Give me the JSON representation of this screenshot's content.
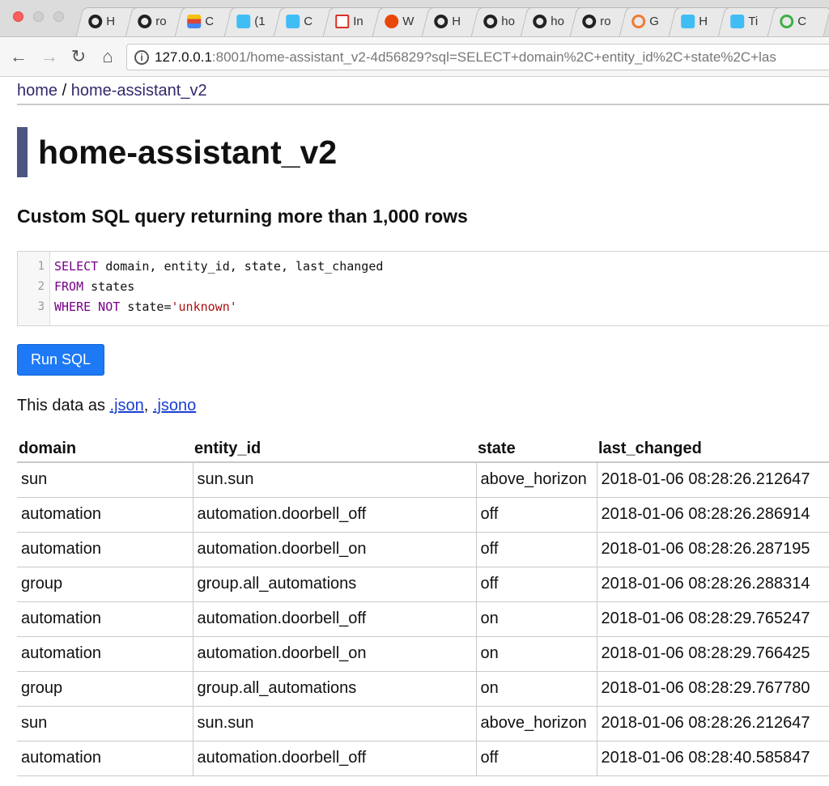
{
  "browser": {
    "tabs": [
      {
        "label": "H",
        "icon": "github-icon"
      },
      {
        "label": "ro",
        "icon": "github-icon"
      },
      {
        "label": "C",
        "icon": "stacked-bars-icon"
      },
      {
        "label": "(1",
        "icon": "home-assistant-icon"
      },
      {
        "label": "C",
        "icon": "home-assistant-icon"
      },
      {
        "label": "In",
        "icon": "gmail-icon"
      },
      {
        "label": "W",
        "icon": "alert-icon"
      },
      {
        "label": "H",
        "icon": "github-icon"
      },
      {
        "label": "ho",
        "icon": "github-icon"
      },
      {
        "label": "ho",
        "icon": "github-icon"
      },
      {
        "label": "ro",
        "icon": "github-icon"
      },
      {
        "label": "G",
        "icon": "ring-icon"
      },
      {
        "label": "H",
        "icon": "home-assistant-icon"
      },
      {
        "label": "Ti",
        "icon": "home-assistant-icon"
      },
      {
        "label": "C",
        "icon": "loading-ring-icon"
      }
    ],
    "url_host": "127.0.0.1",
    "url_rest": ":8001/home-assistant_v2-4d56829?sql=SELECT+domain%2C+entity_id%2C+state%2C+las"
  },
  "breadcrumb": {
    "home": "home",
    "separator": " / ",
    "db": "home-assistant_v2"
  },
  "page_title": "home-assistant_v2",
  "query_heading": "Custom SQL query returning more than 1,000 rows",
  "editor": {
    "lines": [
      {
        "no": "1",
        "kw1": "SELECT",
        "rest": " domain, entity_id, state, last_changed"
      },
      {
        "no": "2",
        "kw1": "FROM",
        "rest": " states"
      },
      {
        "no": "3",
        "kw1": "WHERE NOT",
        "rest": " state=",
        "str": "'unknown'"
      }
    ]
  },
  "run_button": "Run SQL",
  "export": {
    "prefix": "This data as ",
    "json": ".json",
    "sep": ", ",
    "jsono": ".jsono"
  },
  "table": {
    "columns": [
      "domain",
      "entity_id",
      "state",
      "last_changed"
    ],
    "rows": [
      [
        "sun",
        "sun.sun",
        "above_horizon",
        "2018-01-06 08:28:26.212647"
      ],
      [
        "automation",
        "automation.doorbell_off",
        "off",
        "2018-01-06 08:28:26.286914"
      ],
      [
        "automation",
        "automation.doorbell_on",
        "off",
        "2018-01-06 08:28:26.287195"
      ],
      [
        "group",
        "group.all_automations",
        "off",
        "2018-01-06 08:28:26.288314"
      ],
      [
        "automation",
        "automation.doorbell_off",
        "on",
        "2018-01-06 08:28:29.765247"
      ],
      [
        "automation",
        "automation.doorbell_on",
        "on",
        "2018-01-06 08:28:29.766425"
      ],
      [
        "group",
        "group.all_automations",
        "on",
        "2018-01-06 08:28:29.767780"
      ],
      [
        "sun",
        "sun.sun",
        "above_horizon",
        "2018-01-06 08:28:26.212647"
      ],
      [
        "automation",
        "automation.doorbell_off",
        "off",
        "2018-01-06 08:28:40.585847"
      ]
    ]
  },
  "colors": {
    "accent_bar": "#4d5582",
    "button": "#1d79f5",
    "link": "#1a3fd1"
  }
}
